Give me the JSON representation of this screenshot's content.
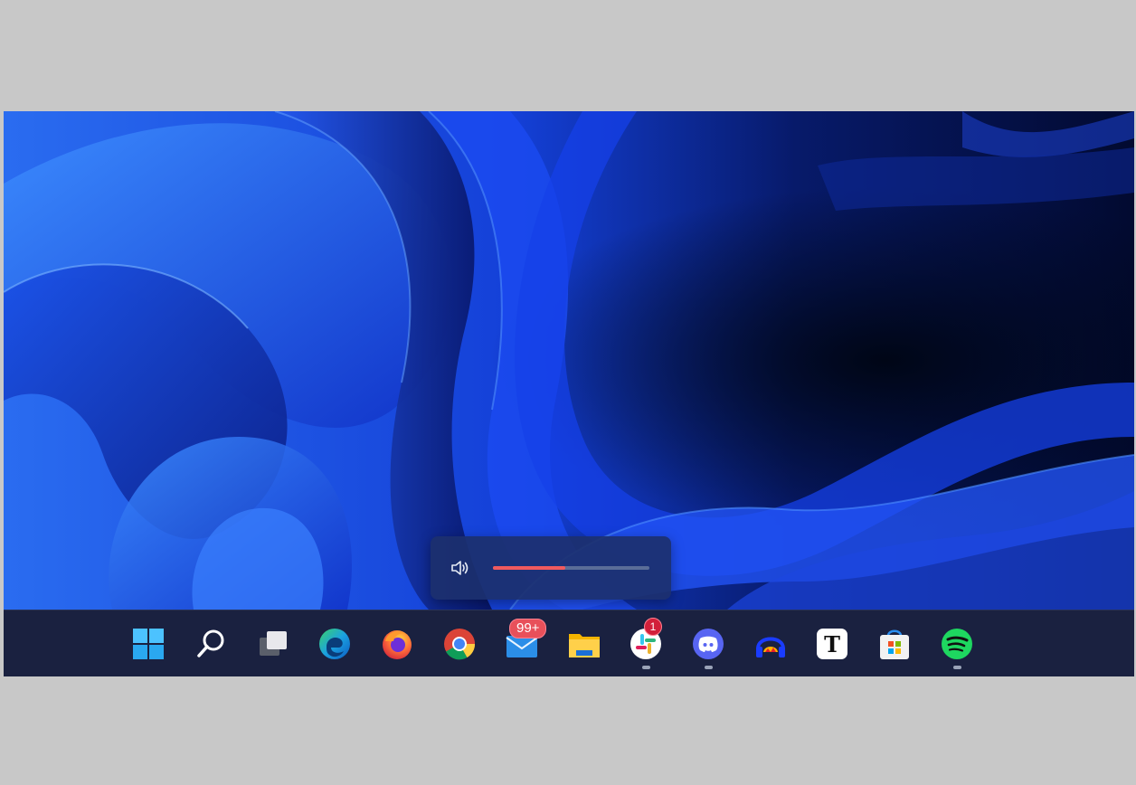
{
  "volume": {
    "level_percent": 46,
    "accent_color": "#f05a5e",
    "icon": "speaker-icon"
  },
  "taskbar": {
    "items": [
      {
        "name": "start",
        "icon": "windows-logo-icon",
        "running": false
      },
      {
        "name": "search",
        "icon": "search-icon",
        "running": false
      },
      {
        "name": "task-view",
        "icon": "task-view-icon",
        "running": false
      },
      {
        "name": "edge",
        "icon": "edge-icon",
        "running": false
      },
      {
        "name": "firefox",
        "icon": "firefox-icon",
        "running": false
      },
      {
        "name": "chrome",
        "icon": "chrome-icon",
        "running": false
      },
      {
        "name": "mail",
        "icon": "mail-icon",
        "running": false,
        "badge": "99+"
      },
      {
        "name": "file-explorer",
        "icon": "folder-icon",
        "running": false
      },
      {
        "name": "slack",
        "icon": "slack-icon",
        "running": true,
        "badge": "1"
      },
      {
        "name": "discord",
        "icon": "discord-icon",
        "running": true
      },
      {
        "name": "audio-app",
        "icon": "headphones-icon",
        "running": false
      },
      {
        "name": "typora",
        "icon": "typora-icon",
        "running": false,
        "glyph": "T"
      },
      {
        "name": "microsoft-store",
        "icon": "store-icon",
        "running": false
      },
      {
        "name": "spotify",
        "icon": "spotify-icon",
        "running": true
      }
    ]
  }
}
